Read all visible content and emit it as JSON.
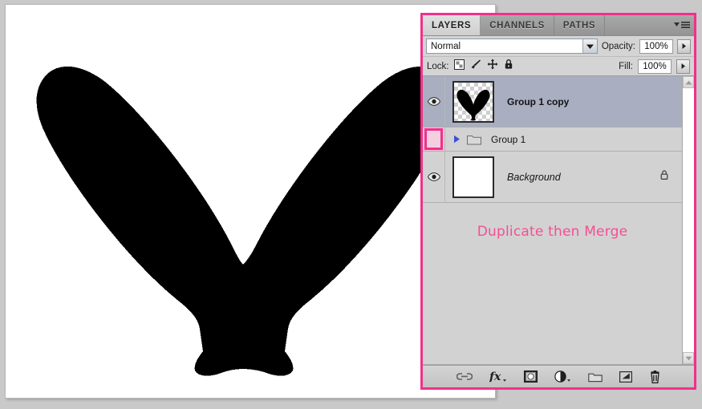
{
  "app": {
    "panel_title": "Layers",
    "accent_pink": "#f2308c",
    "panel_bg": "#d2d2d2",
    "selected_row_bg": "#a9aec0"
  },
  "canvas": {
    "description": "Pixelated black butterfly silhouette on white background",
    "art_color": "#000000",
    "background_color": "#ffffff"
  },
  "panel": {
    "tabs": [
      {
        "label": "LAYERS",
        "active": true,
        "name": "tab-layers"
      },
      {
        "label": "CHANNELS",
        "active": false,
        "name": "tab-channels"
      },
      {
        "label": "PATHS",
        "active": false,
        "name": "tab-paths"
      }
    ],
    "menu_icon": "panel-menu-icon",
    "blend": {
      "value": "Normal",
      "placeholder": "Normal",
      "dropdown_icon": "chevron-down-icon"
    },
    "opacity": {
      "label": "Opacity:",
      "value": "100%",
      "stepper_icon": "chevron-right-icon"
    },
    "lock": {
      "label": "Lock:",
      "icons": [
        {
          "name": "lock-transparent-pixels-icon",
          "glyph": "checkerboard-square"
        },
        {
          "name": "lock-image-pixels-icon",
          "glyph": "paintbrush"
        },
        {
          "name": "lock-position-icon",
          "glyph": "move-cross"
        },
        {
          "name": "lock-all-icon",
          "glyph": "padlock"
        }
      ]
    },
    "fill": {
      "label": "Fill:",
      "value": "100%",
      "stepper_icon": "chevron-right-icon"
    },
    "layers": [
      {
        "name": "Group 1 copy",
        "visible": true,
        "selected": true,
        "type": "layer",
        "thumbnail": "butterfly-transparent",
        "italic": false,
        "locked": false,
        "annotated_eye": false
      },
      {
        "name": "Group 1",
        "visible": false,
        "selected": false,
        "type": "group",
        "thumbnail": "folder",
        "italic": false,
        "locked": false,
        "annotated_eye": true,
        "expand_icon": "expand-triangle-icon",
        "folder_icon": "folder-icon"
      },
      {
        "name": "Background",
        "visible": true,
        "selected": false,
        "type": "layer",
        "thumbnail": "white",
        "italic": true,
        "locked": true,
        "annotated_eye": false,
        "lock_icon": "padlock-icon"
      }
    ],
    "annotation": {
      "text": "Duplicate then Merge",
      "color": "#f54e94"
    },
    "scrollbar": {
      "up_icon": "chevron-up-icon",
      "down_icon": "chevron-down-icon"
    },
    "bottom_toolbar": [
      {
        "name": "link-layers-button",
        "icon": "chain-link-icon",
        "label": "Link layers"
      },
      {
        "name": "layer-style-button",
        "icon": "fx-icon",
        "label": "Add a layer style"
      },
      {
        "name": "layer-mask-button",
        "icon": "mask-icon",
        "label": "Add layer mask"
      },
      {
        "name": "adjustment-layer-button",
        "icon": "half-circle-icon",
        "label": "Create new fill or adjustment layer"
      },
      {
        "name": "new-group-button",
        "icon": "folder-icon",
        "label": "Create a new group"
      },
      {
        "name": "new-layer-button",
        "icon": "new-layer-icon",
        "label": "Create a new layer"
      },
      {
        "name": "delete-layer-button",
        "icon": "trash-icon",
        "label": "Delete layer"
      }
    ]
  }
}
